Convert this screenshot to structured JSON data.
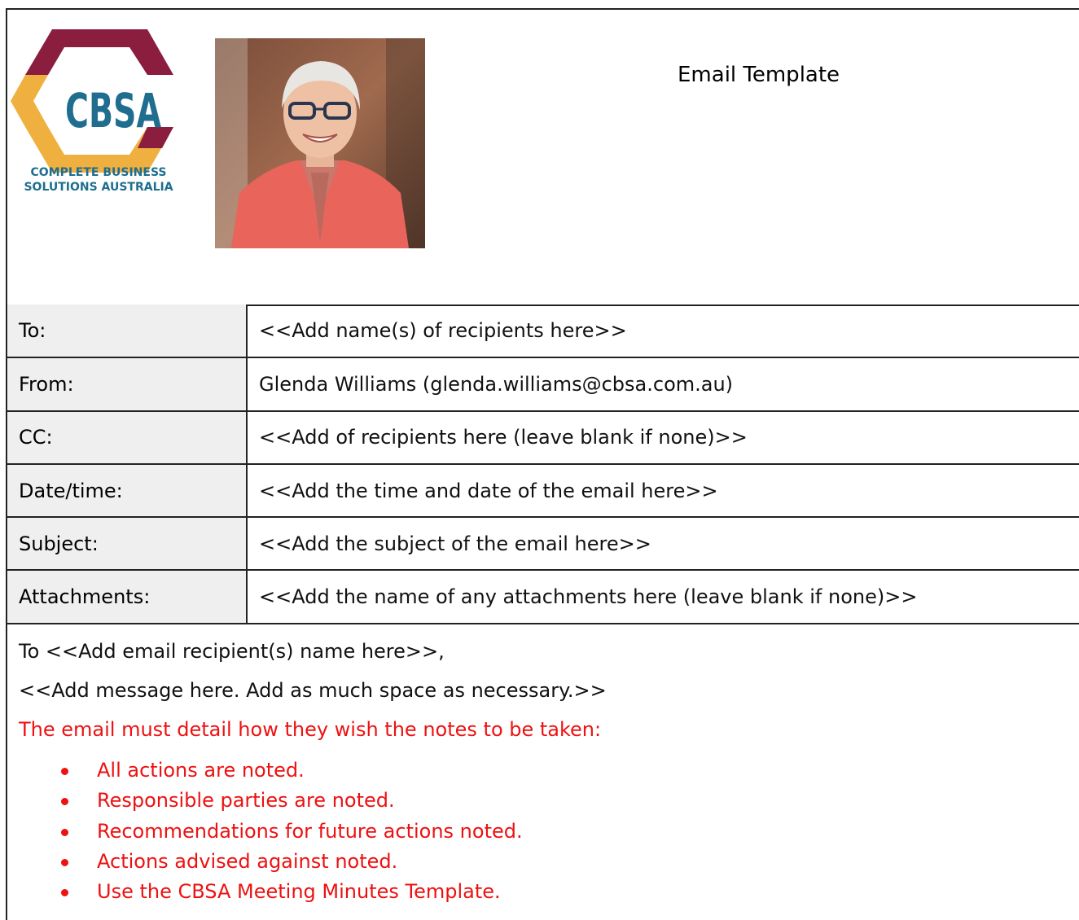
{
  "logo": {
    "wordmark": "CBSA",
    "tagline_line1": "COMPLETE BUSINESS",
    "tagline_line2": "SOLUTIONS AUSTRALIA",
    "colors": {
      "maroon": "#8b1d3f",
      "gold": "#f0b03f",
      "teal": "#1f6d8f"
    }
  },
  "header": {
    "title": "Email Template"
  },
  "fields": [
    {
      "label": "To:",
      "value": "<<Add name(s) of recipients here>>"
    },
    {
      "label": "From:",
      "value": "Glenda Williams (glenda.williams@cbsa.com.au)"
    },
    {
      "label": "CC:",
      "value": "<<Add of recipients here (leave blank if none)>>"
    },
    {
      "label": "Date/time:",
      "value": "<<Add the time and date of the email here>>"
    },
    {
      "label": "Subject:",
      "value": "<<Add the subject of the email here>>"
    },
    {
      "label": "Attachments:",
      "value": "<<Add the name of any attachments here (leave blank if none)>>"
    }
  ],
  "message": {
    "greeting": "To <<Add email recipient(s) name here>>,",
    "body": "<<Add message here. Add as much space as necessary.>>",
    "instruction": "The email must detail how they wish the notes to be taken:",
    "bullets": [
      "All actions are noted.",
      "Responsible parties are noted.",
      "Recommendations for future actions noted.",
      "Actions advised against noted.",
      "Use the CBSA Meeting Minutes Template."
    ]
  },
  "colors": {
    "instruction_red": "#ee1111",
    "label_background": "#efefef",
    "border": "#222222"
  }
}
